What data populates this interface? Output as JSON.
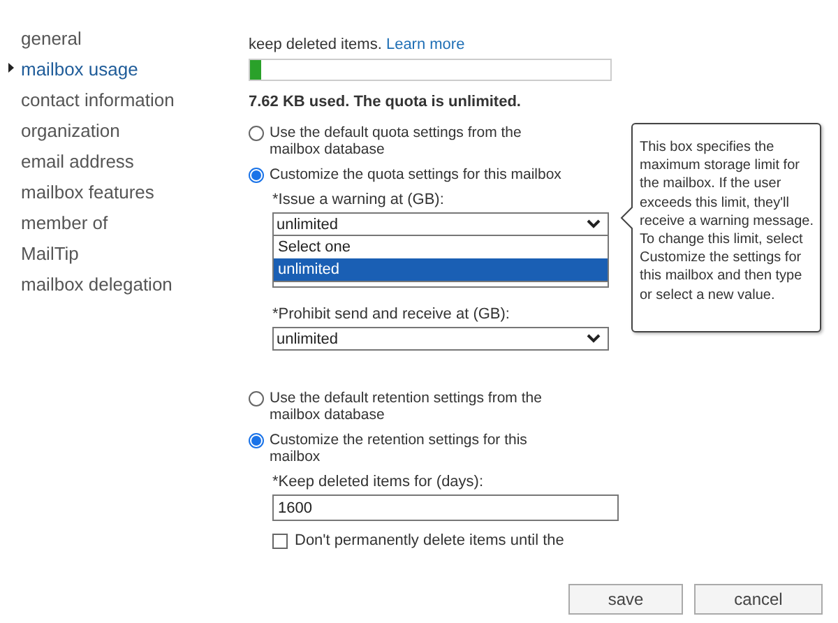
{
  "sidebar": {
    "items": [
      {
        "label": "general",
        "selected": false
      },
      {
        "label": "mailbox usage",
        "selected": true
      },
      {
        "label": "contact information",
        "selected": false
      },
      {
        "label": "organization",
        "selected": false
      },
      {
        "label": "email address",
        "selected": false
      },
      {
        "label": "mailbox features",
        "selected": false
      },
      {
        "label": "member of",
        "selected": false
      },
      {
        "label": "MailTip",
        "selected": false
      },
      {
        "label": "mailbox delegation",
        "selected": false
      }
    ]
  },
  "usage": {
    "intro": "keep deleted items.",
    "link": "Learn more",
    "level": 0.03,
    "summary": "7.62 KB used. The quota is unlimited."
  },
  "quota_options": [
    {
      "label": "Use the default quota settings from the mailbox database",
      "selected": false
    },
    {
      "label": "Customize the quota settings for this mailbox",
      "selected": true
    }
  ],
  "warning_field": {
    "label": "*Issue a warning at (GB):",
    "value": "unlimited",
    "options": [
      {
        "label": "Select one",
        "selected": false
      },
      {
        "label": "unlimited",
        "selected": true
      }
    ]
  },
  "prohibit_field": {
    "label": "*Prohibit send and receive at (GB):",
    "value": "unlimited"
  },
  "tooltip": "This box specifies the maximum storage limit for the mailbox. If the user exceeds this limit, they'll receive a warning message. To change this limit, select Customize the settings for this mailbox and then type or select a new value.",
  "retention_options": [
    {
      "label": "Use the default retention settings from the mailbox database",
      "selected": false
    },
    {
      "label": "Customize the retention settings for this mailbox",
      "selected": true
    }
  ],
  "keep_field": {
    "label": "*Keep deleted items for (days):",
    "value": "1600"
  },
  "keep_checkbox": {
    "label": "Don't permanently delete items until the",
    "checked": false
  },
  "buttons": [
    "save",
    "cancel"
  ]
}
